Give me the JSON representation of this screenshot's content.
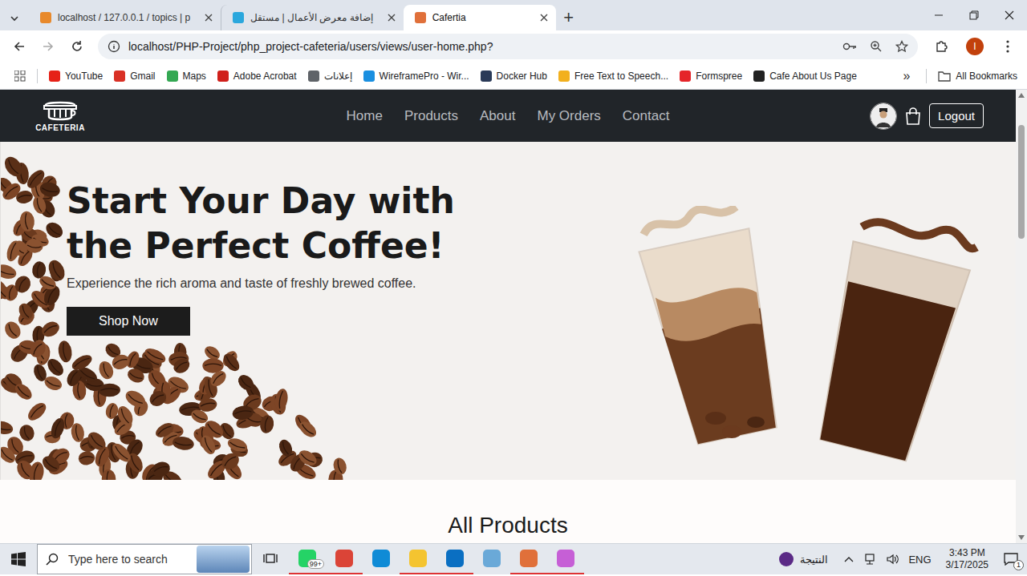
{
  "browser": {
    "tabs": [
      {
        "label": "localhost / 127.0.0.1 / topics | p",
        "selected": false,
        "color": "#e8892b"
      },
      {
        "label": "إضافة معرض الأعمال | مستقل",
        "selected": false,
        "color": "#2aa7dd"
      },
      {
        "label": "Cafertia",
        "selected": true,
        "color": "#e0703a"
      }
    ],
    "new_tab": "+",
    "address": "localhost/PHP-Project/php_project-cafeteria/users/views/user-home.php?",
    "profile_initial": "I",
    "bookmarks": [
      {
        "label": "YouTube",
        "color": "#e62117"
      },
      {
        "label": "Gmail",
        "color": "#d93025"
      },
      {
        "label": "Maps",
        "color": "#34a853"
      },
      {
        "label": "Adobe Acrobat",
        "color": "#d0201b"
      },
      {
        "label": "إعلانات",
        "color": "#5f6368"
      },
      {
        "label": "WireframePro - Wir...",
        "color": "#1a8fe0"
      },
      {
        "label": "Docker Hub",
        "color": "#2a3a58"
      },
      {
        "label": "Free Text to Speech...",
        "color": "#f2b01e"
      },
      {
        "label": "Formspree",
        "color": "#e5252a"
      },
      {
        "label": "Cafe About Us Page",
        "color": "#222222"
      }
    ],
    "more_bookmarks": "»",
    "all_bookmarks": "All Bookmarks"
  },
  "page": {
    "logo": "CAFETERIA",
    "nav": [
      "Home",
      "Products",
      "About",
      "My Orders",
      "Contact"
    ],
    "logout": "Logout",
    "hero": {
      "title": "Start Your Day with the Perfect Coffee!",
      "subtitle": "Experience the rich aroma and taste of freshly brewed coffee.",
      "button": "Shop Now"
    },
    "section_title": "All Products",
    "scrollbar": {
      "level": 0.28
    }
  },
  "taskbar": {
    "search_placeholder": "Type here to search",
    "apps": [
      {
        "color": "#25d366",
        "running": true,
        "badge": "99+"
      },
      {
        "color": "#db4437",
        "running": true,
        "badge": ""
      },
      {
        "color": "#0f8bd6",
        "running": false,
        "badge": ""
      },
      {
        "color": "#f4c430",
        "running": true,
        "badge": ""
      },
      {
        "color": "#0a6fc2",
        "running": true,
        "badge": ""
      },
      {
        "color": "#6aa9d8",
        "running": false,
        "badge": ""
      },
      {
        "color": "#e0703a",
        "running": true,
        "badge": ""
      },
      {
        "color": "#c65fd6",
        "running": true,
        "badge": ""
      }
    ],
    "weather": "النتيجة",
    "language": "ENG",
    "time": "3:43 PM",
    "date": "3/17/2025",
    "notifications": "1"
  }
}
